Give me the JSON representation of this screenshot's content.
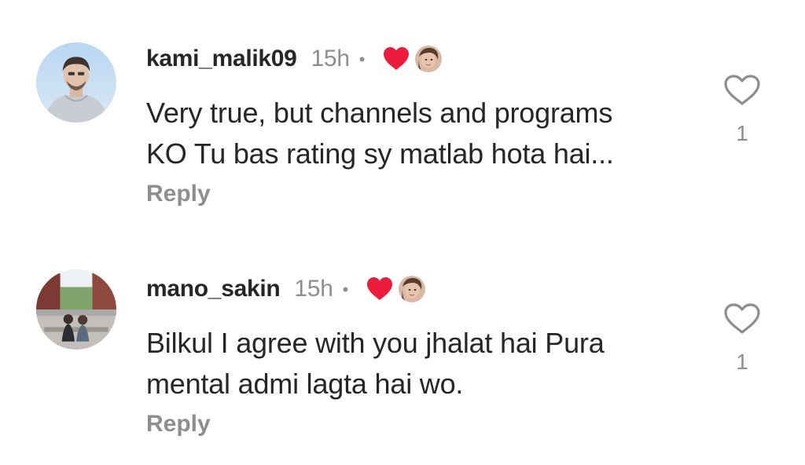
{
  "comments": [
    {
      "username": "kami_malik09",
      "time": "15h",
      "separator": "•",
      "lines": [
        "Very true, but channels and programs",
        "KO Tu bas rating sy matlab hota hai..."
      ],
      "reply_label": "Reply",
      "like_count": "1",
      "liked_by_author_icon": "heart-icon",
      "like_icon": "heart-outline-icon"
    },
    {
      "username": "mano_sakin",
      "time": "15h",
      "separator": "•",
      "lines": [
        "Bilkul I agree with you jhalat hai Pura",
        "mental admi lagta hai wo."
      ],
      "reply_label": "Reply",
      "like_count": "1",
      "liked_by_author_icon": "heart-icon",
      "like_icon": "heart-outline-icon"
    }
  ],
  "colors": {
    "text": "#262626",
    "secondary": "#8e8e8e",
    "heart": "#ed1c3c"
  }
}
